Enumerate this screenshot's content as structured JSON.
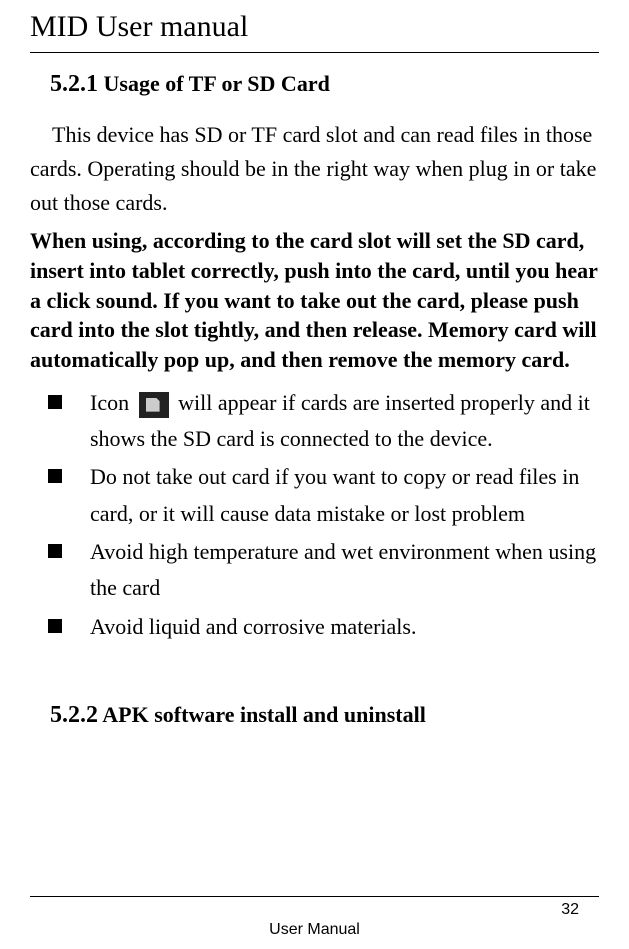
{
  "header": {
    "title": "MID User manual"
  },
  "section1": {
    "number": "5.2.1",
    "title": "Usage of TF or SD Card",
    "intro": "This device has SD or TF card slot and can read files in those cards. Operating should be in the right way when plug in or take out those cards.",
    "bold_block": "When using, according to the card slot will set the SD card, insert into tablet correctly, push into the card, until you hear a click sound. If you want to take out the card, please push card into the slot tightly, and then release. Memory card will automatically pop up, and then remove the memory card.",
    "bullets": [
      {
        "prefix": "Icon ",
        "has_icon": true,
        "suffix": " will appear if cards are inserted properly and it shows the SD card is connected to the device."
      },
      {
        "prefix": "Do not take out card if you want to copy or read files in card, or it will cause data mistake or lost problem",
        "has_icon": false,
        "suffix": ""
      },
      {
        "prefix": "Avoid high temperature and wet environment when using the card",
        "has_icon": false,
        "suffix": ""
      },
      {
        "prefix": "Avoid liquid and corrosive materials.",
        "has_icon": false,
        "suffix": ""
      }
    ]
  },
  "section2": {
    "number": "5.2.2",
    "title": "APK software install and uninstall"
  },
  "footer": {
    "page_number": "32",
    "label": "User Manual"
  }
}
